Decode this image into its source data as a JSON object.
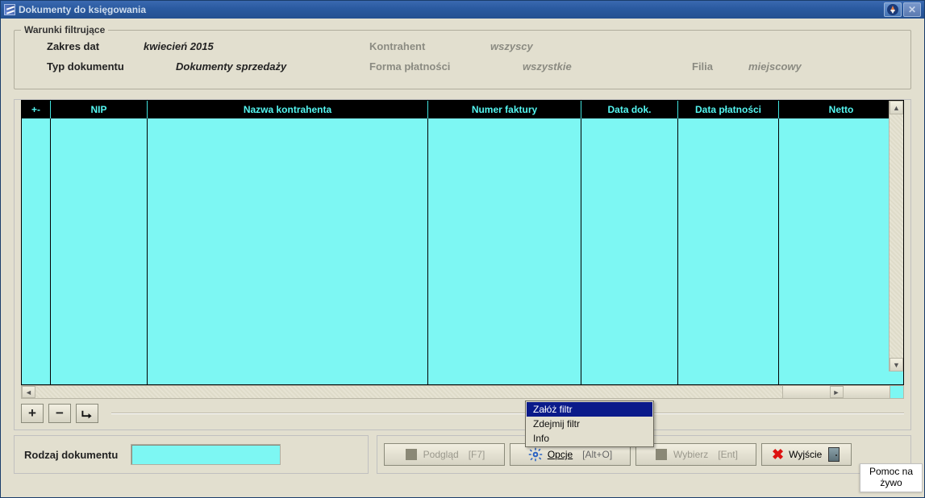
{
  "window": {
    "title": "Dokumenty do księgowania"
  },
  "filters": {
    "legend": "Warunki filtrujące",
    "dateRange": {
      "label": "Zakres dat",
      "value": "kwiecień 2015"
    },
    "docType": {
      "label": "Typ dokumentu",
      "value": "Dokumenty sprzedaży"
    },
    "contractor": {
      "label": "Kontrahent",
      "value": "wszyscy"
    },
    "paymentForm": {
      "label": "Forma płatności",
      "value": "wszystkie"
    },
    "branch": {
      "label": "Filia",
      "value": "miejscowy"
    }
  },
  "grid": {
    "columns": [
      "+-",
      "NIP",
      "Nazwa kontrahenta",
      "Numer faktury",
      "Data dok.",
      "Data płatności",
      "Netto"
    ],
    "rows": []
  },
  "smallButtons": {
    "add": "+",
    "remove": "−",
    "confirm": "✓"
  },
  "docKind": {
    "label": "Rodzaj dokumentu",
    "value": ""
  },
  "actions": {
    "preview": {
      "label": "Podgląd",
      "shortcut": "[F7]"
    },
    "options": {
      "label": "Opcje",
      "shortcut": "[Alt+O]"
    },
    "choose": {
      "label": "Wybierz",
      "shortcut": "[Ent]"
    },
    "exit": {
      "label": "Wyjście"
    }
  },
  "contextMenu": {
    "items": [
      {
        "label": "Załóż filtr",
        "selected": true
      },
      {
        "label": "Zdejmij filtr",
        "selected": false
      },
      {
        "label": "Info",
        "selected": false
      }
    ]
  },
  "liveHelp": "Pomoc na żywo"
}
